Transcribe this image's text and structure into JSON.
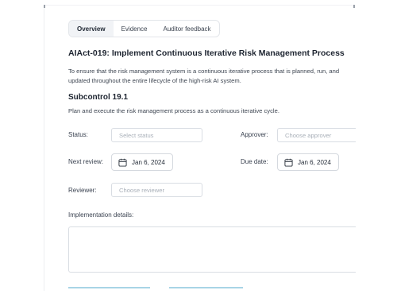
{
  "tabs": [
    {
      "label": "Overview",
      "active": true
    },
    {
      "label": "Evidence",
      "active": false
    },
    {
      "label": "Auditor feedback",
      "active": false
    }
  ],
  "control": {
    "title": "AIAct-019: Implement Continuous Iterative Risk Management Process",
    "description": "To ensure that the risk management system is a continuous iterative process that is planned, run, and updated throughout the entire lifecycle of the high-risk AI system."
  },
  "subcontrol": {
    "title": "Subcontrol 19.1",
    "description": "Plan and execute the risk management process as a continuous iterative cycle."
  },
  "form": {
    "status": {
      "label": "Status:",
      "placeholder": "Select status"
    },
    "approver": {
      "label": "Approver:",
      "placeholder": "Choose approver"
    },
    "next_review": {
      "label": "Next review:",
      "value": "Jan 6, 2024"
    },
    "due_date": {
      "label": "Due date:",
      "value": "Jan 6, 2024"
    },
    "reviewer": {
      "label": "Reviewer:",
      "placeholder": "Choose reviewer"
    },
    "implementation": {
      "label": "Implementation details:",
      "value": ""
    }
  },
  "icons": {
    "calendar": "calendar-icon"
  },
  "colors": {
    "accent_button": "#a8d4e6",
    "border": "#d9dde3"
  }
}
